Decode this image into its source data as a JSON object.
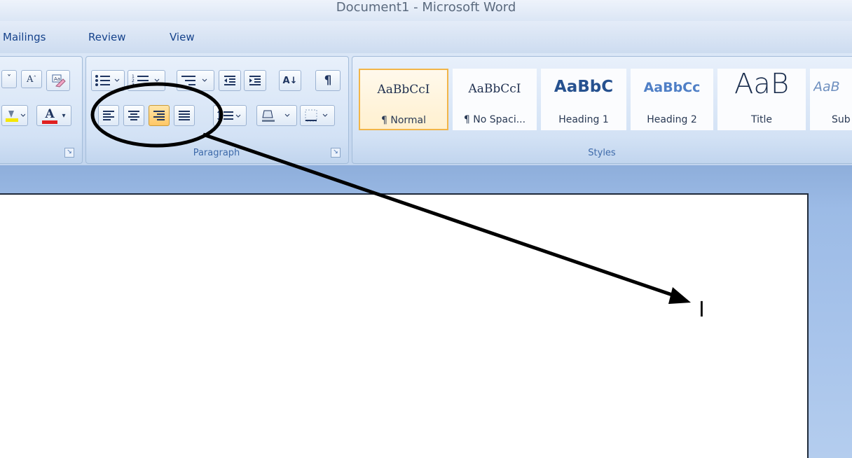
{
  "window": {
    "title": "Document1 - Microsoft Word"
  },
  "tabs": [
    {
      "label": "Mailings"
    },
    {
      "label": "Review"
    },
    {
      "label": "View"
    }
  ],
  "font_group": {
    "grow_font": "A",
    "font_color_letter": "A",
    "font_color_hex": "#e02020",
    "highlight_color_hex": "#f5e600"
  },
  "paragraph_group": {
    "label": "Paragraph",
    "sort_glyph": "A↓",
    "show_marks_glyph": "¶",
    "active_alignment": "align-right"
  },
  "styles_group": {
    "label": "Styles",
    "items": [
      {
        "sample": "AaBbCcI",
        "name": "¶ Normal",
        "selected": true
      },
      {
        "sample": "AaBbCcI",
        "name": "¶ No Spaci...",
        "selected": false
      },
      {
        "sample": "AaBbC",
        "name": "Heading 1",
        "selected": false
      },
      {
        "sample": "AaBbCc",
        "name": "Heading 2",
        "selected": false
      },
      {
        "sample": "AaB",
        "name": "Title",
        "selected": false
      },
      {
        "sample": "AaB",
        "name": "Sub",
        "selected": false
      }
    ]
  },
  "document": {
    "cursor_glyph": "I"
  },
  "annotation": {
    "shape": "ellipse around alignment buttons with arrow pointing to cursor",
    "color": "#000000"
  }
}
